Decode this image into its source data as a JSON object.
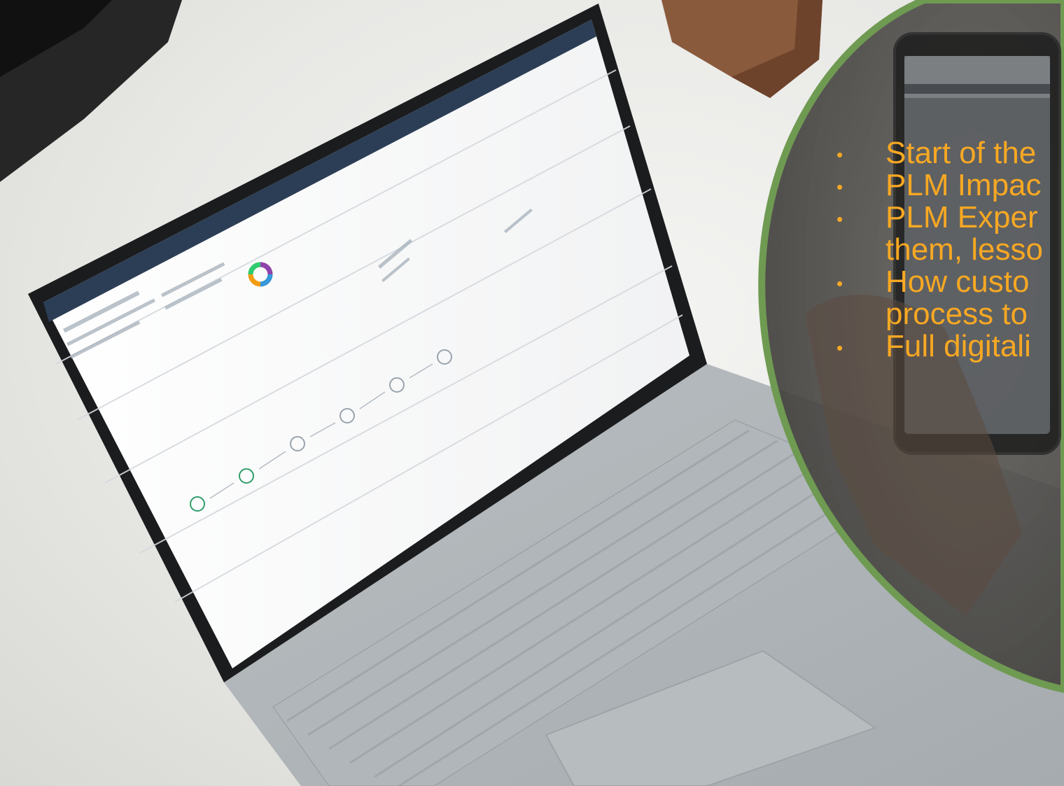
{
  "overlay": {
    "accent_color": "#f7a823",
    "circle_border_color": "#6f9a52",
    "bullet_symbol": "•",
    "bullets": [
      {
        "line1": "Start of the",
        "line2": ""
      },
      {
        "line1": "PLM Impac",
        "line2": ""
      },
      {
        "line1": "PLM Exper",
        "line2": "them, lesso"
      },
      {
        "line1": "How custo",
        "line2": "process to"
      },
      {
        "line1": "Full digitali",
        "line2": ""
      }
    ]
  },
  "photo": {
    "subject": "laptop-with-plm-app-and-phone",
    "icons": [
      "laptop-icon",
      "smartphone-icon",
      "donut-chart-icon",
      "process-flow-icon"
    ]
  }
}
